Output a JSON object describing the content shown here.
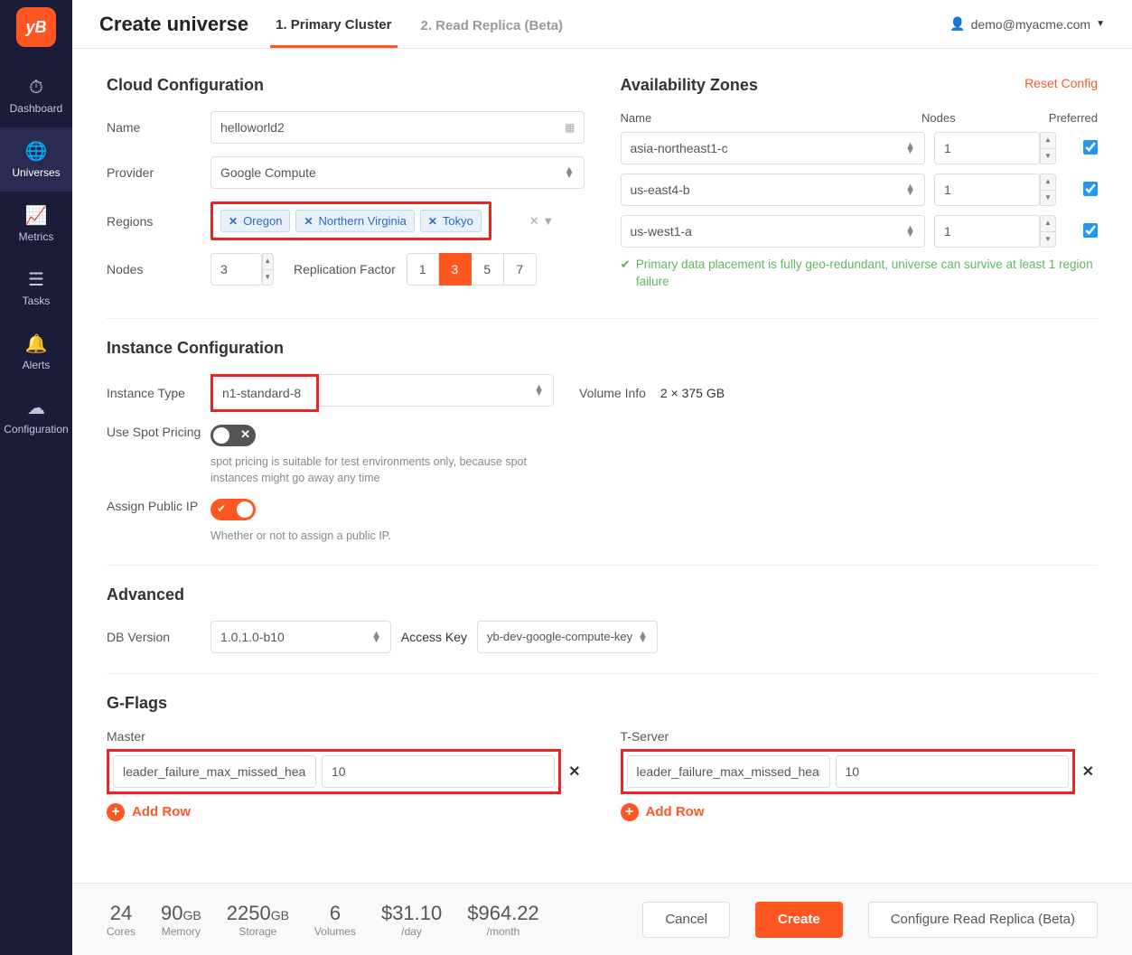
{
  "logo": "yB",
  "nav": [
    {
      "icon": "⏱",
      "label": "Dashboard"
    },
    {
      "icon": "🌐",
      "label": "Universes"
    },
    {
      "icon": "📈",
      "label": "Metrics"
    },
    {
      "icon": "☰",
      "label": "Tasks"
    },
    {
      "icon": "🔔",
      "label": "Alerts"
    },
    {
      "icon": "☁",
      "label": "Configuration"
    }
  ],
  "page_title": "Create universe",
  "tabs": [
    "1. Primary Cluster",
    "2. Read Replica (Beta)"
  ],
  "user_email": "demo@myacme.com",
  "cloud_config": {
    "heading": "Cloud Configuration",
    "name_label": "Name",
    "name_value": "helloworld2",
    "provider_label": "Provider",
    "provider_value": "Google Compute",
    "regions_label": "Regions",
    "regions": [
      "Oregon",
      "Northern Virginia",
      "Tokyo"
    ],
    "nodes_label": "Nodes",
    "nodes_value": "3",
    "rf_label": "Replication Factor",
    "rf_options": [
      "1",
      "3",
      "5",
      "7"
    ],
    "rf_selected": "3"
  },
  "az": {
    "heading": "Availability Zones",
    "reset": "Reset Config",
    "col_name": "Name",
    "col_nodes": "Nodes",
    "col_pref": "Preferred",
    "rows": [
      {
        "name": "asia-northeast1-c",
        "nodes": "1",
        "preferred": true
      },
      {
        "name": "us-east4-b",
        "nodes": "1",
        "preferred": true
      },
      {
        "name": "us-west1-a",
        "nodes": "1",
        "preferred": true
      }
    ],
    "msg": "Primary data placement is fully geo-redundant, universe can survive at least 1 region failure"
  },
  "instance": {
    "heading": "Instance Configuration",
    "type_label": "Instance Type",
    "type_value": "n1-standard-8",
    "volume_label": "Volume Info",
    "volume_value": "2 × 375 GB",
    "spot_label": "Use Spot Pricing",
    "spot_help": "spot pricing is suitable for test environments only, because spot instances might go away any time",
    "ip_label": "Assign Public IP",
    "ip_help": "Whether or not to assign a public IP."
  },
  "advanced": {
    "heading": "Advanced",
    "db_label": "DB Version",
    "db_value": "1.0.1.0-b10",
    "key_label": "Access Key",
    "key_value": "yb-dev-google-compute-key"
  },
  "gflags": {
    "heading": "G-Flags",
    "master_label": "Master",
    "tserver_label": "T-Server",
    "master": {
      "key": "leader_failure_max_missed_heart",
      "val": "10"
    },
    "tserver": {
      "key": "leader_failure_max_missed_heart",
      "val": "10"
    },
    "add_row": "Add Row"
  },
  "footer": {
    "cores": "24",
    "cores_label": "Cores",
    "memory": "90",
    "memory_unit": "GB",
    "memory_label": "Memory",
    "storage": "2250",
    "storage_unit": "GB",
    "storage_label": "Storage",
    "volumes": "6",
    "volumes_label": "Volumes",
    "day": "$31.10",
    "day_label": "/day",
    "month": "$964.22",
    "month_label": "/month",
    "cancel": "Cancel",
    "create": "Create",
    "replica": "Configure Read Replica (Beta)"
  }
}
